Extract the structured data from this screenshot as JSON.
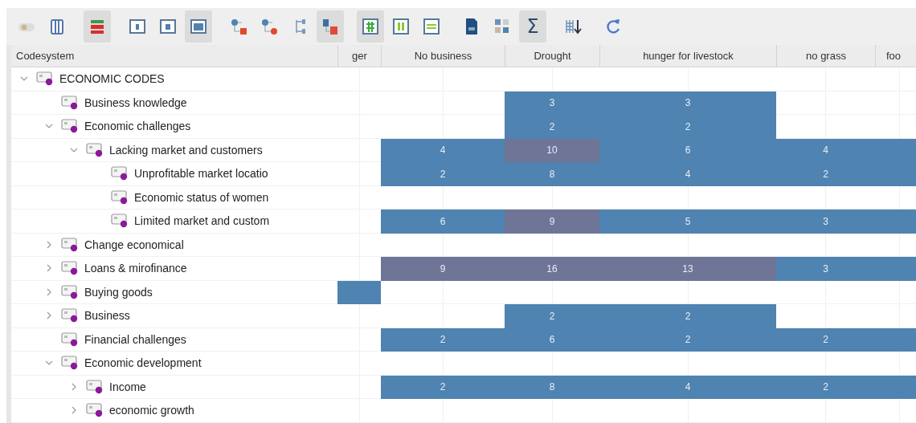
{
  "toolbar": {
    "groups": [
      [
        {
          "kind": "toggle",
          "selected": false
        },
        {
          "kind": "columns",
          "selected": false
        }
      ],
      [
        {
          "kind": "bars",
          "selected": true
        }
      ],
      [
        {
          "kind": "window-small",
          "selected": false
        },
        {
          "kind": "window-medium",
          "selected": false
        },
        {
          "kind": "window-large",
          "selected": true
        }
      ],
      [
        {
          "kind": "branch-square",
          "selected": false
        },
        {
          "kind": "branch-dot",
          "selected": false
        },
        {
          "kind": "branch-plain",
          "selected": false
        },
        {
          "kind": "branch-red",
          "selected": true
        }
      ],
      [
        {
          "kind": "grid-green",
          "selected": true
        },
        {
          "kind": "columns-green",
          "selected": false
        },
        {
          "kind": "rows-green",
          "selected": false
        }
      ],
      [
        {
          "kind": "document",
          "selected": false
        },
        {
          "kind": "tiles",
          "selected": false
        },
        {
          "kind": "glyph",
          "glyph": "Σ",
          "selected": true
        }
      ],
      [
        {
          "kind": "sort",
          "selected": false
        }
      ],
      [
        {
          "kind": "refresh",
          "selected": false
        }
      ]
    ]
  },
  "table": {
    "tree_header": "Codesystem",
    "columns": [
      "ger",
      "No business",
      "Drought",
      "hunger for livestock",
      "no grass",
      "foo"
    ],
    "tree": [
      {
        "label": "ECONOMIC CODES",
        "expanded": true,
        "cells": [
          null,
          null,
          null,
          null,
          null,
          null
        ],
        "children": [
          {
            "label": "Business knowledge",
            "cells": [
              null,
              null,
              {
                "value": "3",
                "color": "#4f83b1"
              },
              {
                "value": "3",
                "color": "#4f83b1"
              },
              null,
              null
            ]
          },
          {
            "label": "Economic challenges",
            "expanded": true,
            "cells": [
              null,
              null,
              {
                "value": "2",
                "color": "#4f83b1"
              },
              {
                "value": "2",
                "color": "#4f83b1"
              },
              null,
              null
            ],
            "children": [
              {
                "label": "Lacking market and customers",
                "expanded": true,
                "cells": [
                  null,
                  {
                    "value": "4",
                    "color": "#4f83b1"
                  },
                  {
                    "value": "10",
                    "color": "#6e7597"
                  },
                  {
                    "value": "6",
                    "color": "#4f83b1"
                  },
                  {
                    "value": "4",
                    "color": "#4f83b1"
                  },
                  {
                    "color": "#4f83b1"
                  }
                ],
                "children": [
                  {
                    "label": "Unprofitable market locatio",
                    "cells": [
                      null,
                      {
                        "value": "2",
                        "color": "#4f83b1"
                      },
                      {
                        "value": "8",
                        "color": "#4f83b1"
                      },
                      {
                        "value": "4",
                        "color": "#4f83b1"
                      },
                      {
                        "value": "2",
                        "color": "#4f83b1"
                      },
                      {
                        "color": "#4f83b1"
                      }
                    ]
                  },
                  {
                    "label": "Economic status of women",
                    "cells": [
                      null,
                      null,
                      null,
                      null,
                      null,
                      null
                    ]
                  },
                  {
                    "label": "Limited market and custom",
                    "cells": [
                      null,
                      {
                        "value": "6",
                        "color": "#4f83b1"
                      },
                      {
                        "value": "9",
                        "color": "#6e7597"
                      },
                      {
                        "value": "5",
                        "color": "#4f83b1"
                      },
                      {
                        "value": "3",
                        "color": "#4f83b1"
                      },
                      {
                        "color": "#4f83b1"
                      }
                    ]
                  }
                ]
              }
            ]
          },
          {
            "label": "Change economical",
            "expanded": false,
            "cells": [
              null,
              null,
              null,
              null,
              null,
              null
            ]
          },
          {
            "label": "Loans & mirofinance",
            "expanded": false,
            "cells": [
              null,
              {
                "value": "9",
                "color": "#6e7597"
              },
              {
                "value": "16",
                "color": "#6e7597"
              },
              {
                "value": "13",
                "color": "#6e7597"
              },
              {
                "value": "3",
                "color": "#4f83b1"
              },
              {
                "color": "#4f83b1"
              }
            ]
          },
          {
            "label": "Buying goods",
            "expanded": false,
            "cells": [
              {
                "color": "#4f83b1"
              },
              null,
              null,
              null,
              null,
              null
            ]
          },
          {
            "label": "Business",
            "expanded": false,
            "cells": [
              null,
              null,
              {
                "value": "2",
                "color": "#4f83b1"
              },
              {
                "value": "2",
                "color": "#4f83b1"
              },
              null,
              null
            ]
          },
          {
            "label": "Financial challenges",
            "cells": [
              null,
              {
                "value": "2",
                "color": "#4f83b1"
              },
              {
                "value": "6",
                "color": "#4f83b1"
              },
              {
                "value": "2",
                "color": "#4f83b1"
              },
              {
                "value": "2",
                "color": "#4f83b1"
              },
              {
                "color": "#4f83b1"
              }
            ]
          },
          {
            "label": "Economic development",
            "expanded": true,
            "cells": [
              null,
              null,
              null,
              null,
              null,
              null
            ],
            "children": [
              {
                "label": "Income",
                "expanded": false,
                "cells": [
                  null,
                  {
                    "value": "2",
                    "color": "#4f83b1"
                  },
                  {
                    "value": "8",
                    "color": "#4f83b1"
                  },
                  {
                    "value": "4",
                    "color": "#4f83b1"
                  },
                  {
                    "value": "2",
                    "color": "#4f83b1"
                  },
                  {
                    "color": "#4f83b1"
                  }
                ]
              },
              {
                "label": "economic growth",
                "expanded": false,
                "cells": [
                  null,
                  null,
                  null,
                  null,
                  null,
                  null
                ]
              }
            ]
          }
        ]
      }
    ]
  }
}
